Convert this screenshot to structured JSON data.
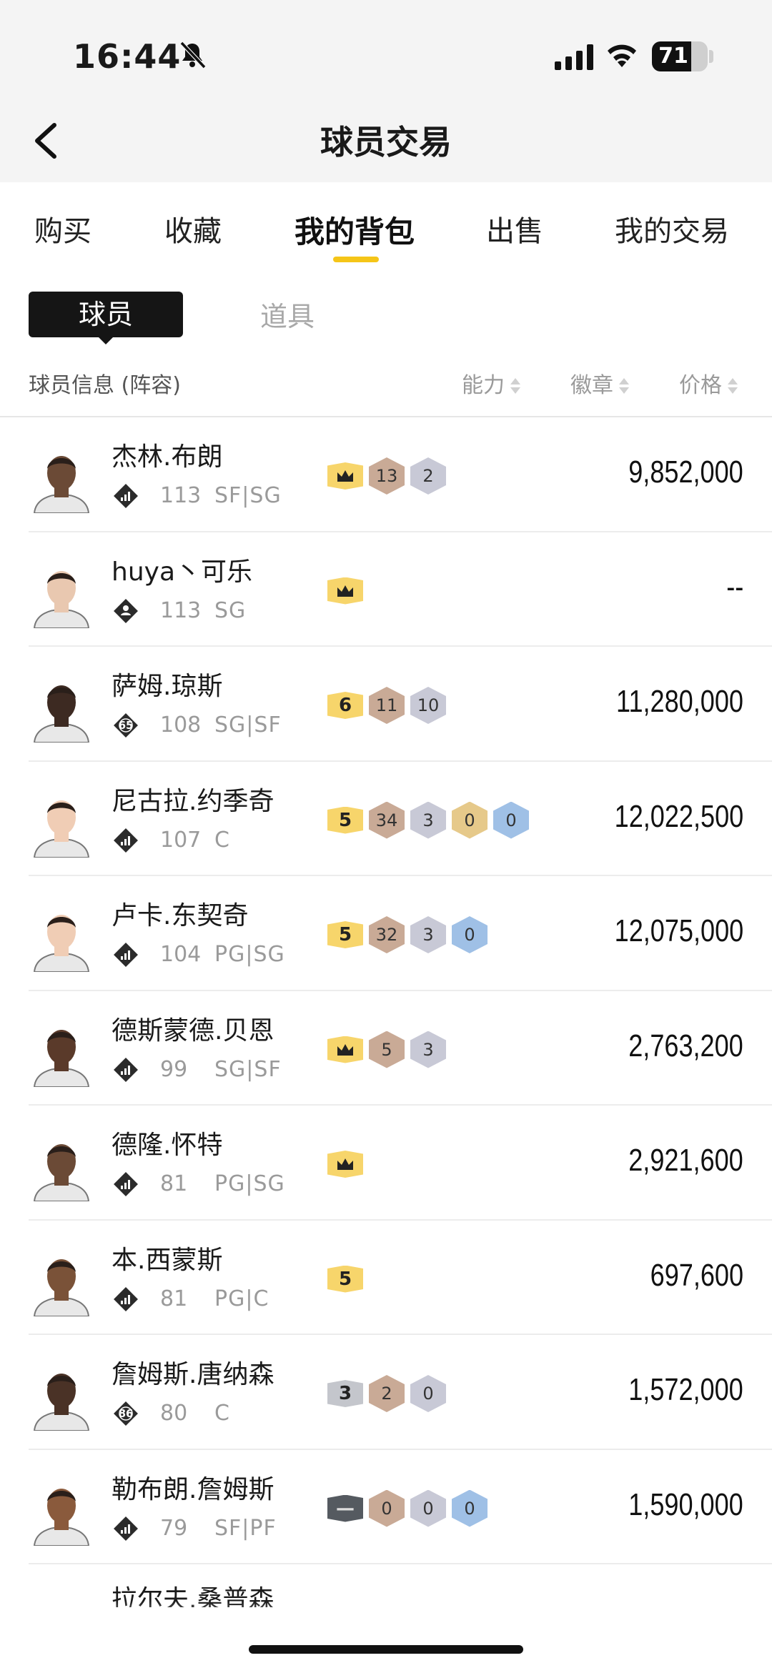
{
  "status_bar": {
    "time": "16:44",
    "battery": "71",
    "battery_level": 0.71
  },
  "header": {
    "title": "球员交易"
  },
  "tabs": [
    {
      "label": "购买",
      "active": false
    },
    {
      "label": "收藏",
      "active": false
    },
    {
      "label": "我的背包",
      "active": true
    },
    {
      "label": "出售",
      "active": false
    },
    {
      "label": "我的交易",
      "active": false
    }
  ],
  "subtabs": {
    "players": "球员",
    "items": "道具"
  },
  "columns": {
    "info": "球员信息 (阵容)",
    "ability": "能力",
    "badge": "徽章",
    "price": "价格"
  },
  "colors": {
    "accent": "#f5c518",
    "gold_tier": "#f7d56b",
    "bronze": "#c9aa96",
    "silver": "#c8c9d6",
    "gold": "#e6c98a",
    "blue": "#9fc0e6",
    "grey_tier": "#c4c6cc",
    "dark_tier": "#555a60"
  },
  "players": [
    {
      "name": "杰林.布朗",
      "ovr": "113",
      "pos": "SF|SG",
      "icon": "signal-icon",
      "role_num": "",
      "badges": [
        {
          "kind": "tier",
          "type": "crown"
        },
        {
          "kind": "hex",
          "type": "bronze",
          "value": "13"
        },
        {
          "kind": "hex",
          "type": "silver",
          "value": "2"
        }
      ],
      "price": "9,852,000"
    },
    {
      "name": "huya丶可乐",
      "ovr": "113",
      "pos": "SG",
      "icon": "person-icon",
      "role_num": "",
      "badges": [
        {
          "kind": "tier",
          "type": "crown"
        }
      ],
      "price": "--"
    },
    {
      "name": "萨姆.琼斯",
      "ovr": "108",
      "pos": "SG|SF",
      "icon": "number-icon",
      "role_num": "65",
      "badges": [
        {
          "kind": "tier",
          "type": "gold",
          "value": "6"
        },
        {
          "kind": "hex",
          "type": "bronze",
          "value": "11"
        },
        {
          "kind": "hex",
          "type": "silver",
          "value": "10"
        }
      ],
      "price": "11,280,000"
    },
    {
      "name": "尼古拉.约季奇",
      "ovr": "107",
      "pos": "C",
      "icon": "signal-icon",
      "role_num": "",
      "badges": [
        {
          "kind": "tier",
          "type": "gold",
          "value": "5"
        },
        {
          "kind": "hex",
          "type": "bronze",
          "value": "34"
        },
        {
          "kind": "hex",
          "type": "silver",
          "value": "3"
        },
        {
          "kind": "hex",
          "type": "gold",
          "value": "0"
        },
        {
          "kind": "hex",
          "type": "blue",
          "value": "0"
        }
      ],
      "price": "12,022,500"
    },
    {
      "name": "卢卡.东契奇",
      "ovr": "104",
      "pos": "PG|SG",
      "icon": "signal-icon",
      "role_num": "",
      "badges": [
        {
          "kind": "tier",
          "type": "gold",
          "value": "5"
        },
        {
          "kind": "hex",
          "type": "bronze",
          "value": "32"
        },
        {
          "kind": "hex",
          "type": "silver",
          "value": "3"
        },
        {
          "kind": "hex",
          "type": "blue",
          "value": "0"
        }
      ],
      "price": "12,075,000"
    },
    {
      "name": "德斯蒙德.贝恩",
      "ovr": "99",
      "pos": "SG|SF",
      "icon": "signal-icon",
      "role_num": "",
      "badges": [
        {
          "kind": "tier",
          "type": "crown"
        },
        {
          "kind": "hex",
          "type": "bronze",
          "value": "5"
        },
        {
          "kind": "hex",
          "type": "silver",
          "value": "3"
        }
      ],
      "price": "2,763,200"
    },
    {
      "name": "德隆.怀特",
      "ovr": "81",
      "pos": "PG|SG",
      "icon": "signal-icon",
      "role_num": "",
      "badges": [
        {
          "kind": "tier",
          "type": "crown"
        }
      ],
      "price": "2,921,600"
    },
    {
      "name": "本.西蒙斯",
      "ovr": "81",
      "pos": "PG|C",
      "icon": "signal-icon",
      "role_num": "",
      "badges": [
        {
          "kind": "tier",
          "type": "gold",
          "value": "5"
        }
      ],
      "price": "697,600"
    },
    {
      "name": "詹姆斯.唐纳森",
      "ovr": "80",
      "pos": "C",
      "icon": "number-icon",
      "role_num": "86",
      "badges": [
        {
          "kind": "tier",
          "type": "grey",
          "value": "3"
        },
        {
          "kind": "hex",
          "type": "bronze",
          "value": "2"
        },
        {
          "kind": "hex",
          "type": "silver",
          "value": "0"
        }
      ],
      "price": "1,572,000"
    },
    {
      "name": "勒布朗.詹姆斯",
      "ovr": "79",
      "pos": "SF|PF",
      "icon": "signal-icon",
      "role_num": "",
      "badges": [
        {
          "kind": "tier",
          "type": "dark",
          "value": "—"
        },
        {
          "kind": "hex",
          "type": "bronze",
          "value": "0"
        },
        {
          "kind": "hex",
          "type": "silver",
          "value": "0"
        },
        {
          "kind": "hex",
          "type": "blue",
          "value": "0"
        }
      ],
      "price": "1,590,000"
    }
  ],
  "partial_player": {
    "name": "拉尔夫.桑普森"
  }
}
